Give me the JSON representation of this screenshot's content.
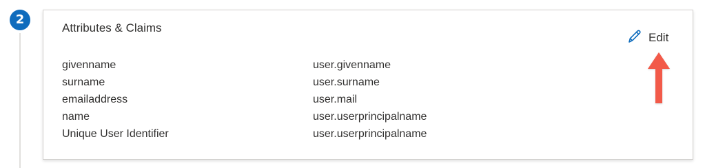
{
  "step": {
    "number": "2"
  },
  "card": {
    "title": "Attributes & Claims",
    "edit_label": "Edit",
    "claims": [
      {
        "name": "givenname",
        "value": "user.givenname"
      },
      {
        "name": "surname",
        "value": "user.surname"
      },
      {
        "name": "emailaddress",
        "value": "user.mail"
      },
      {
        "name": "name",
        "value": "user.userprincipalname"
      },
      {
        "name": "Unique User Identifier",
        "value": "user.userprincipalname"
      }
    ]
  },
  "colors": {
    "accent": "#0f6cbd",
    "annotation_arrow": "#f25a4a",
    "text": "#323130",
    "border": "#d2d0ce"
  },
  "icons": {
    "step": "numbered-step-badge",
    "edit": "pencil-icon",
    "annotation": "arrow-up-annotation"
  }
}
